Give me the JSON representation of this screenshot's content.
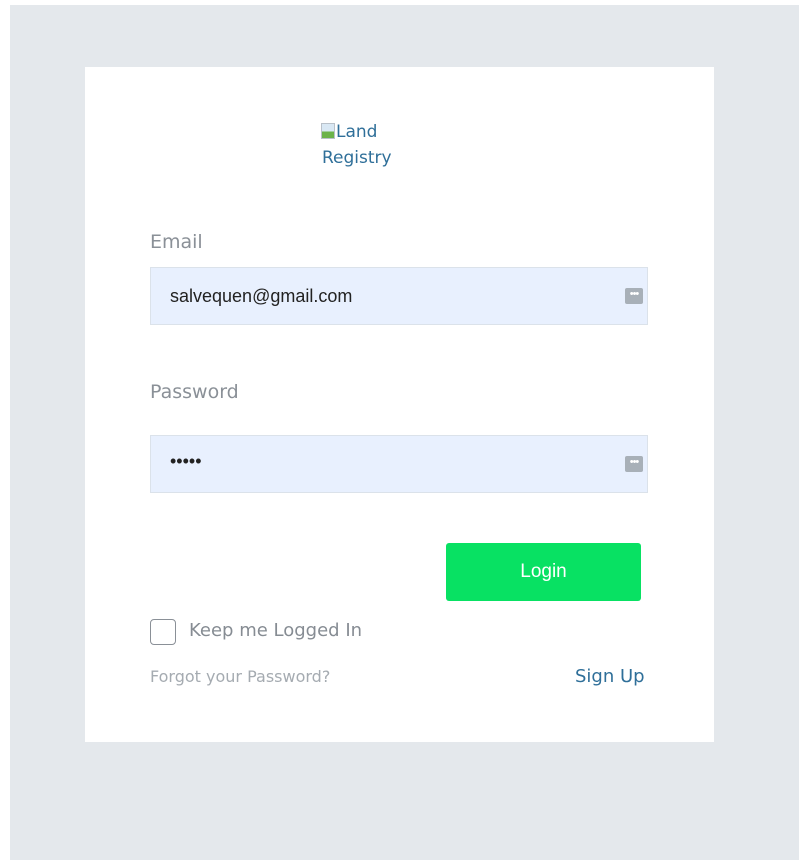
{
  "logo": {
    "alt_line1": "Land",
    "alt_line2": "Registry"
  },
  "form": {
    "email_label": "Email",
    "email_value": "salvequen@gmail.com",
    "password_label": "Password",
    "password_value": "•••••",
    "login_label": "Login",
    "keep_logged_in_label": "Keep me Logged In",
    "keep_logged_in_checked": false,
    "forgot_password_label": "Forgot your Password?",
    "sign_up_label": "Sign Up"
  },
  "icons": {
    "autofill": "keyboard-autofill-icon",
    "autofill_glyph": "•••",
    "broken_image": "broken-image-icon"
  },
  "colors": {
    "background": "#e4e8ec",
    "card": "#ffffff",
    "input_fill": "#e8f0fe",
    "login_button": "#08e163",
    "link": "#2f6f99",
    "label": "#8a9097"
  }
}
